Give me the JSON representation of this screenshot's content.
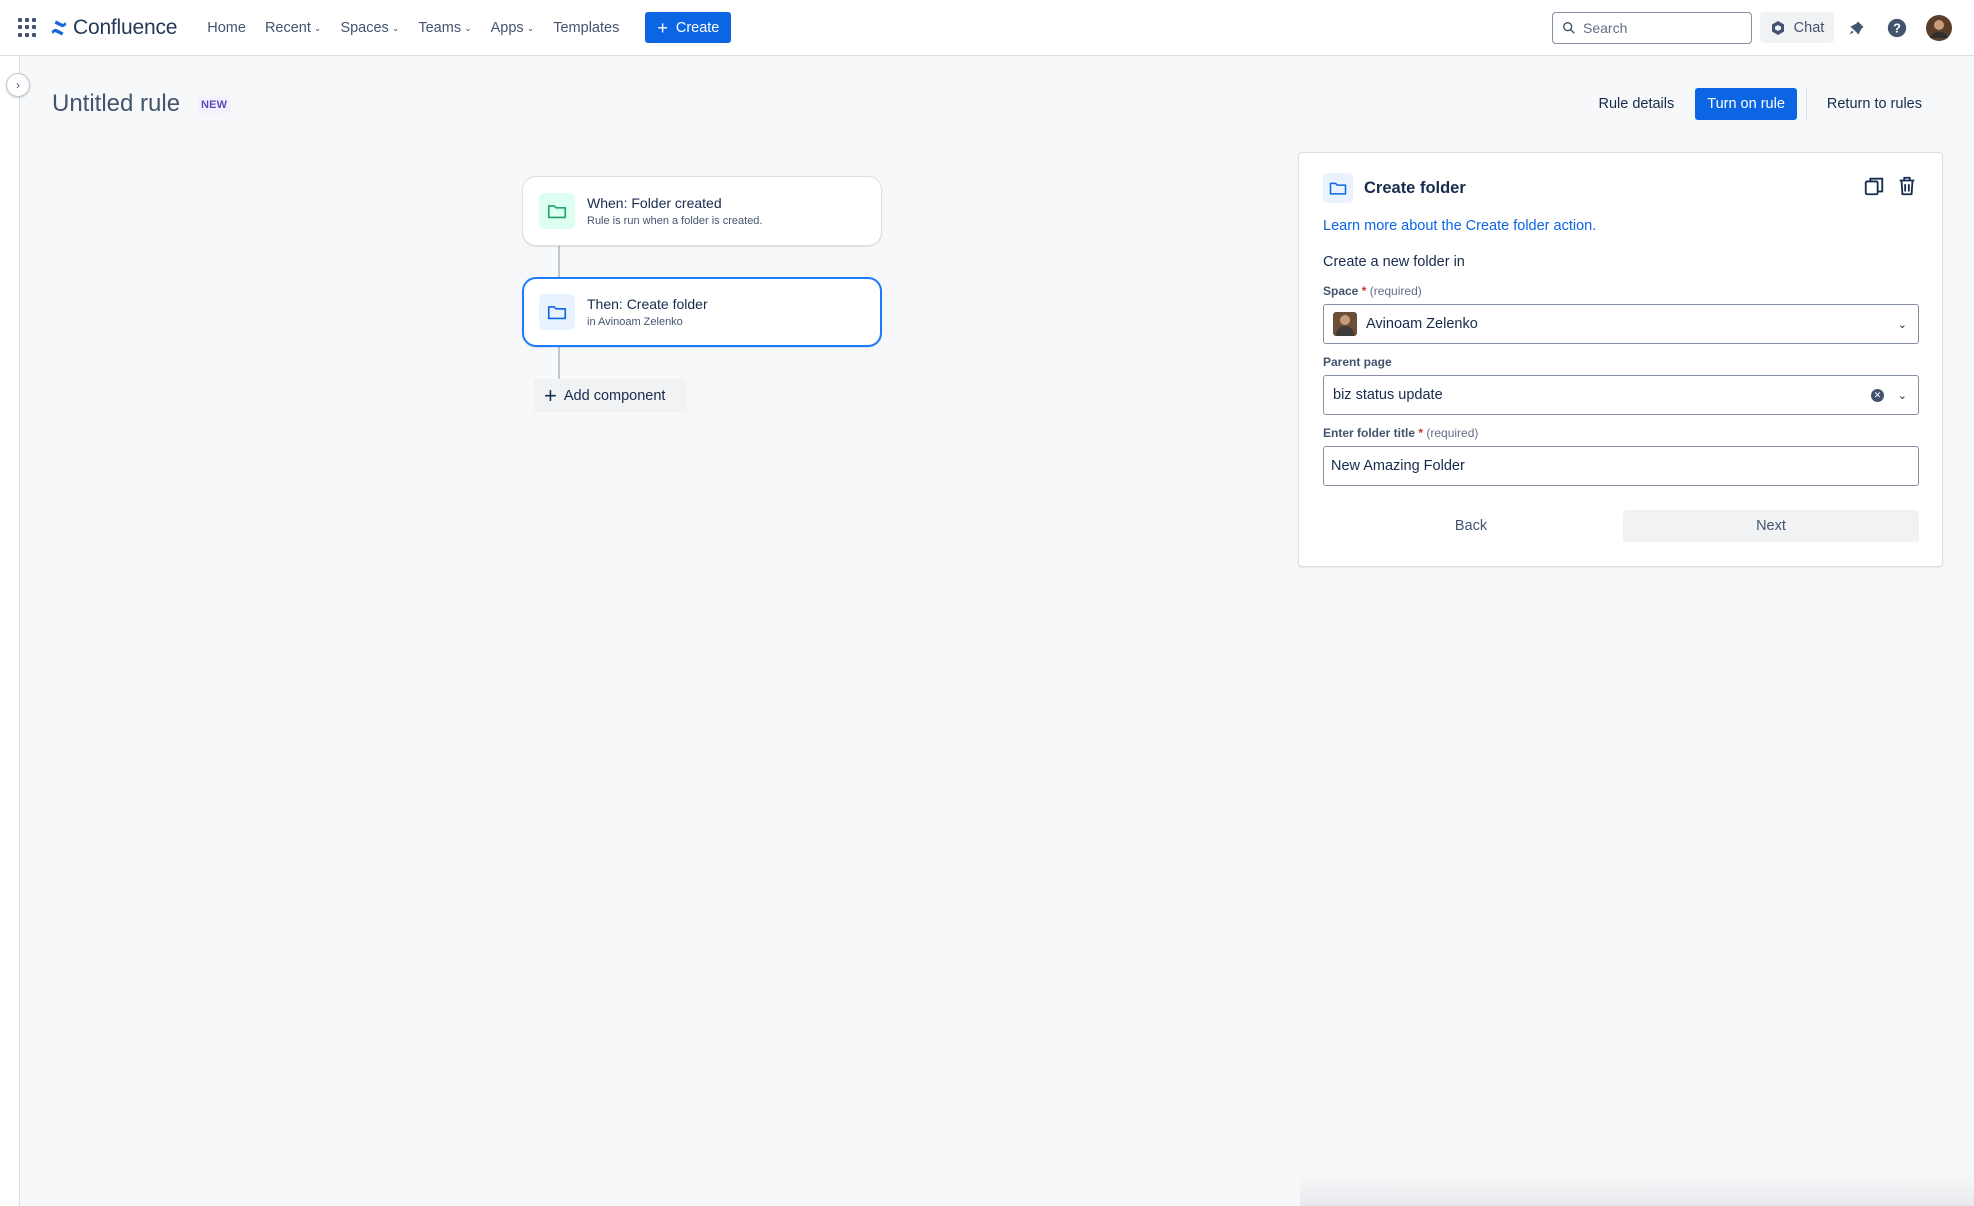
{
  "topnav": {
    "brand": "Confluence",
    "items": [
      {
        "label": "Home",
        "has_dropdown": false
      },
      {
        "label": "Recent",
        "has_dropdown": true
      },
      {
        "label": "Spaces",
        "has_dropdown": true
      },
      {
        "label": "Teams",
        "has_dropdown": true
      },
      {
        "label": "Apps",
        "has_dropdown": true
      },
      {
        "label": "Templates",
        "has_dropdown": false
      }
    ],
    "create_label": "Create",
    "search_placeholder": "Search",
    "chat_label": "Chat"
  },
  "header": {
    "title": "Untitled rule",
    "badge": "NEW",
    "rule_details_label": "Rule details",
    "turn_on_label": "Turn on rule",
    "return_label": "Return to rules"
  },
  "flow": {
    "trigger": {
      "title": "When: Folder created",
      "subtitle": "Rule is run when a folder is created."
    },
    "action": {
      "title": "Then: Create folder",
      "subtitle": "in Avinoam Zelenko"
    },
    "add_component_label": "Add component"
  },
  "panel": {
    "title": "Create folder",
    "learn_more": "Learn more about the Create folder action.",
    "intro": "Create a new folder in",
    "space": {
      "label": "Space",
      "required_mark": "*",
      "required_text": "(required)",
      "value": "Avinoam Zelenko"
    },
    "parent_page": {
      "label": "Parent page",
      "value": "biz status update"
    },
    "folder_title": {
      "label": "Enter folder title",
      "required_mark": "*",
      "required_text": "(required)",
      "value": "New Amazing Folder"
    },
    "back_label": "Back",
    "next_label": "Next"
  },
  "colors": {
    "brand_blue": "#0c66e4",
    "selected_border": "#1d7afc",
    "trigger_icon": "#22a06b",
    "action_icon": "#0c66e4"
  }
}
